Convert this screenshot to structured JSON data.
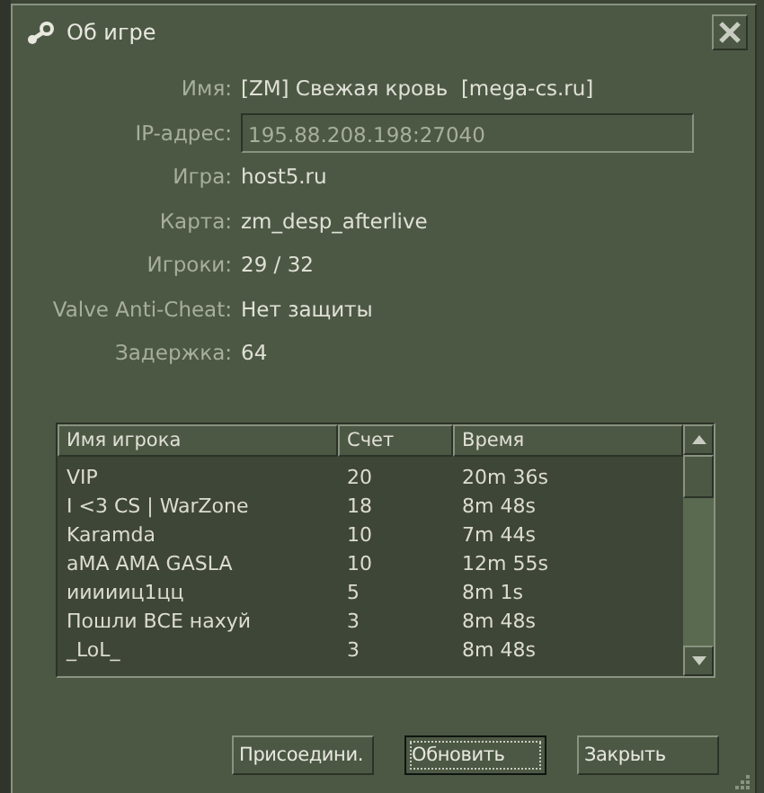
{
  "window": {
    "title": "Об игре"
  },
  "fields": [
    {
      "label": "Имя:",
      "value": "[ZM] Свежая кровь  [mega-cs.ru]",
      "kind": "text"
    },
    {
      "label": "IP-адрес:",
      "value": "195.88.208.198:27040",
      "kind": "input"
    },
    {
      "label": "Игра:",
      "value": "host5.ru",
      "kind": "text"
    },
    {
      "label": "Карта:",
      "value": "zm_desp_afterlive",
      "kind": "text"
    },
    {
      "label": "Игроки:",
      "value": "29 / 32",
      "kind": "text"
    },
    {
      "label": "Valve Anti-Cheat:",
      "value": "Нет защиты",
      "kind": "text"
    },
    {
      "label": "Задержка:",
      "value": "64",
      "kind": "text"
    }
  ],
  "table": {
    "columns": [
      "Имя игрока",
      "Счет",
      "Время"
    ],
    "rows": [
      [
        "VIP",
        "20",
        "20m 36s"
      ],
      [
        "I <3 CS | WarZone",
        "18",
        "8m 48s"
      ],
      [
        "Karamda",
        "10",
        "7m 44s"
      ],
      [
        "aMA AMA GASLA",
        "10",
        "12m 55s"
      ],
      [
        "иииииц1цц",
        "5",
        "8m 1s"
      ],
      [
        "Пошли ВСЕ нахуй",
        "3",
        "8m 48s"
      ],
      [
        "_LoL_",
        "3",
        "8m 48s"
      ]
    ]
  },
  "buttons": [
    {
      "label": "Присоедини.",
      "focused": false
    },
    {
      "label": "Обновить",
      "focused": true
    },
    {
      "label": "Закрыть",
      "focused": false
    }
  ]
}
